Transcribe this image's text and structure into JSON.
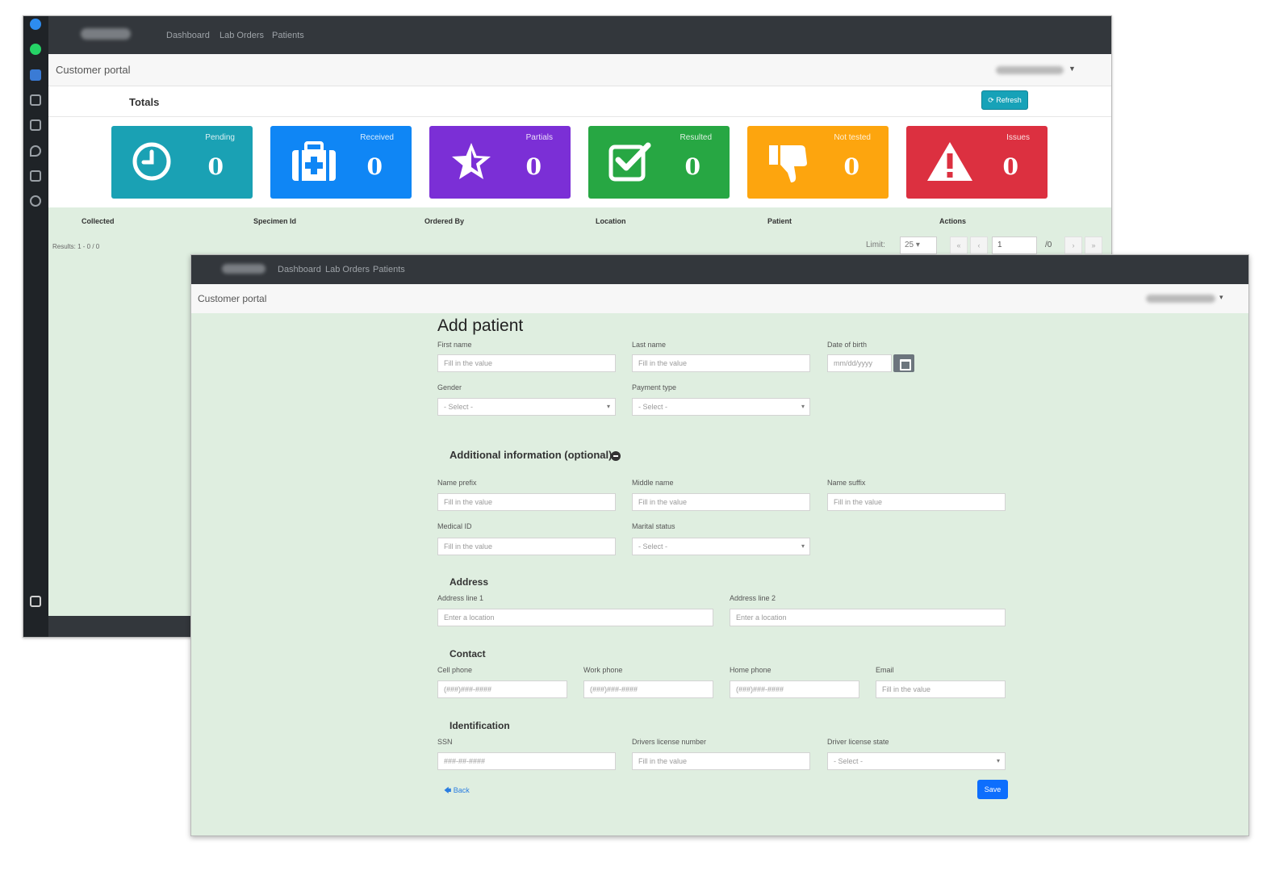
{
  "back_window": {
    "nav": {
      "dashboard": "Dashboard",
      "lab_orders": "Lab Orders",
      "patients": "Patients"
    },
    "portal_title": "Customer portal",
    "totals_title": "Totals",
    "refresh_label": "⟳ Refresh",
    "cards": [
      {
        "label": "Pending",
        "count": "0",
        "color": "#1aa1b4",
        "icon": "clock-icon"
      },
      {
        "label": "Received",
        "count": "0",
        "color": "#0f86f5",
        "icon": "first-aid-kit-icon"
      },
      {
        "label": "Partials",
        "count": "0",
        "color": "#7b2fd6",
        "icon": "star-icon"
      },
      {
        "label": "Resulted",
        "count": "0",
        "color": "#27a743",
        "icon": "check-square-icon"
      },
      {
        "label": "Not tested",
        "count": "0",
        "color": "#fda50e",
        "icon": "thumbs-down-icon"
      },
      {
        "label": "Issues",
        "count": "0",
        "color": "#dc3040",
        "icon": "warning-icon"
      }
    ],
    "table_headers": [
      "Collected",
      "Specimen Id",
      "Ordered By",
      "Location",
      "Patient",
      "Actions"
    ],
    "results_text": "Results: 1 - 0 / 0",
    "pager": {
      "limit_label": "Limit:",
      "limit_value": "25",
      "page_value": "1",
      "page_total": "/0"
    }
  },
  "front_window": {
    "nav": {
      "dashboard": "Dashboard",
      "lab_orders": "Lab Orders",
      "patients": "Patients"
    },
    "portal_title": "Customer portal",
    "form_title": "Add patient",
    "fields": {
      "first_name": {
        "label": "First name",
        "placeholder": "Fill in the value"
      },
      "last_name": {
        "label": "Last name",
        "placeholder": "Fill in the value"
      },
      "dob": {
        "label": "Date of birth",
        "placeholder": "mm/dd/yyyy"
      },
      "gender": {
        "label": "Gender",
        "value": "- Select -"
      },
      "payment_type": {
        "label": "Payment type",
        "value": "- Select -"
      },
      "name_prefix": {
        "label": "Name prefix",
        "placeholder": "Fill in the value"
      },
      "middle_name": {
        "label": "Middle name",
        "placeholder": "Fill in the value"
      },
      "name_suffix": {
        "label": "Name suffix",
        "placeholder": "Fill in the value"
      },
      "medical_id": {
        "label": "Medical ID",
        "placeholder": "Fill in the value"
      },
      "marital_status": {
        "label": "Marital status",
        "value": "- Select -"
      },
      "address1": {
        "label": "Address line 1",
        "placeholder": "Enter a location"
      },
      "address2": {
        "label": "Address line 2",
        "placeholder": "Enter a location"
      },
      "cell_phone": {
        "label": "Cell phone",
        "placeholder": "(###)###-####"
      },
      "work_phone": {
        "label": "Work phone",
        "placeholder": "(###)###-####"
      },
      "home_phone": {
        "label": "Home phone",
        "placeholder": "(###)###-####"
      },
      "email": {
        "label": "Email",
        "placeholder": "Fill in the value"
      },
      "ssn": {
        "label": "SSN",
        "placeholder": "###-##-####"
      },
      "drivers_license": {
        "label": "Drivers license number",
        "placeholder": "Fill in the value"
      },
      "driver_license_state": {
        "label": "Driver license state",
        "value": "- Select -"
      }
    },
    "sections": {
      "additional": "Additional information (optional)",
      "address": "Address",
      "contact": "Contact",
      "identification": "Identification"
    },
    "back_label": "🡄 Back",
    "save_label": "Save"
  }
}
